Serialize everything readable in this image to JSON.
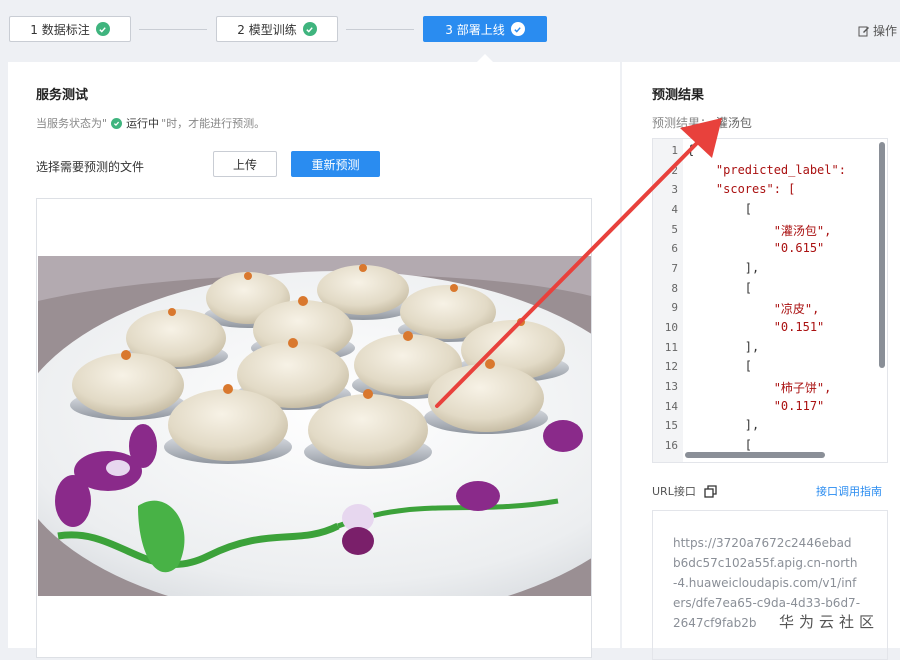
{
  "steps": [
    {
      "label": "1 数据标注",
      "state": "done"
    },
    {
      "label": "2 模型训练",
      "state": "done"
    },
    {
      "label": "3 部署上线",
      "state": "active"
    }
  ],
  "toolbar": {
    "op_log": "操作"
  },
  "service_test": {
    "title": "服务测试",
    "hint_prefix": "当服务状态为\"",
    "hint_status": "运行中",
    "hint_suffix": "\"时，才能进行预测。",
    "file_label": "选择需要预测的文件",
    "upload_button": "上传",
    "repredict_button": "重新预测"
  },
  "prediction": {
    "title": "预测结果",
    "result_label": "预测结果：",
    "result_value": "灌汤包",
    "line_numbers": [
      "1",
      "2",
      "3",
      "4",
      "5",
      "6",
      "7",
      "8",
      "9",
      "10",
      "11",
      "12",
      "13",
      "14",
      "15",
      "16"
    ],
    "code_lines": [
      "{",
      "    \"predicted_label\": ",
      "    \"scores\": [",
      "        [",
      "            \"灌汤包\",",
      "            \"0.615\"",
      "        ],",
      "        [",
      "            \"凉皮\",",
      "            \"0.151\"",
      "        ],",
      "        [",
      "            \"柿子饼\",",
      "            \"0.117\"",
      "        ],",
      "        ["
    ]
  },
  "url": {
    "label": "URL接口",
    "guide_link": "接口调用指南",
    "lines": [
      "https://3720a7672c2446ebad",
      "b6dc57c102a55f.apig.cn-north",
      "-4.huaweicloudapis.com/v1/inf",
      "ers/dfe7ea65-c9da-4d33-b6d7-",
      "2647cf9fab2b"
    ]
  },
  "watermark": "华为云社区",
  "colors": {
    "accent": "#2a8cf0",
    "success": "#3fb47e",
    "annotation_arrow": "#e8413c"
  }
}
